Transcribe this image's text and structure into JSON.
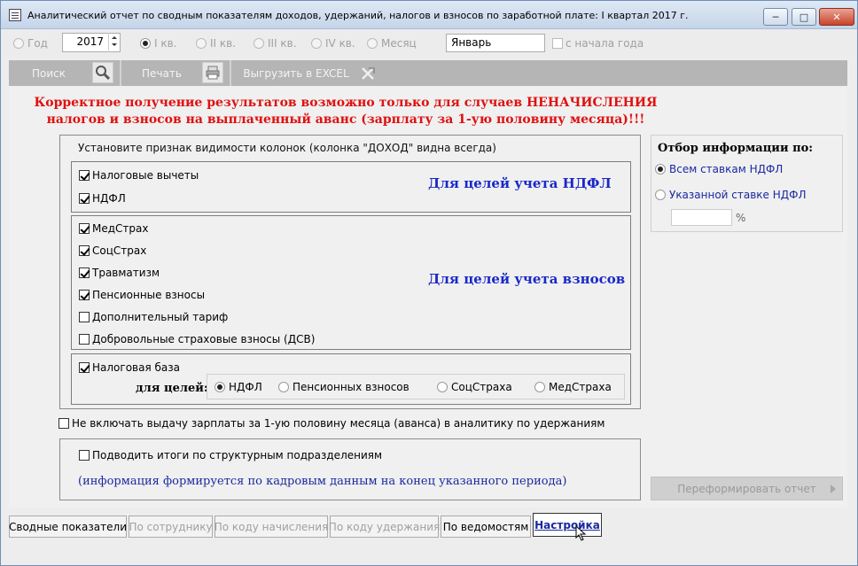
{
  "window": {
    "title": "Аналитический отчет по сводным показателям доходов, удержаний, налогов и взносов по заработной плате: I квартал 2017 г.",
    "minimize": "─",
    "maximize": "□",
    "close": "✕"
  },
  "period": {
    "year_label": "Год",
    "year_value": "2017",
    "q1": "I кв.",
    "q2": "II кв.",
    "q3": "III кв.",
    "q4": "IV кв.",
    "month_label": "Месяц",
    "month_value": "Январь",
    "from_year_start": "с начала года"
  },
  "toolbar": {
    "search": "Поиск",
    "print": "Печать",
    "export": "Выгрузить в EXCEL"
  },
  "warning": {
    "line1": "Корректное получение результатов возможно только для случаев НЕНАЧИСЛЕНИЯ",
    "line2": "налогов и взносов на выплаченный аванс (зарплату за 1-ую половину месяца)!!!"
  },
  "visibility": {
    "caption": "Установите признак видимости колонок (колонка \"ДОХОД\" видна всегда)",
    "ndfl_title": "Для целей учета НДФЛ",
    "tax_deductions": "Налоговые вычеты",
    "ndfl": "НДФЛ",
    "contrib_title": "Для целей учета взносов",
    "med": "МедСтрах",
    "soc": "СоцСтрах",
    "injury": "Травматизм",
    "pension": "Пенсионные взносы",
    "extra_tariff": "Дополнительный тариф",
    "voluntary": "Добровольные страховые взносы (ДСВ)",
    "tax_base": "Налоговая база",
    "purpose_label": "для целей:",
    "purpose_ndfl": "НДФЛ",
    "purpose_pension": "Пенсионных взносов",
    "purpose_soc": "СоцСтраха",
    "purpose_med": "МедСтраха"
  },
  "exclude_advance": "Не включать выдачу зарплаты за 1-ую половину месяца (аванса) в аналитику по удержаниям",
  "subdivisions": {
    "label": "Подводить итоги по структурным подразделениям",
    "note": "(информация формируется по кадровым данным на конец указанного периода)"
  },
  "filter": {
    "title": "Отбор информации по:",
    "all_rates": "Всем ставкам НДФЛ",
    "specified_rate": "Указанной ставке НДФЛ",
    "percent": "%"
  },
  "reform_button": "Переформировать отчет",
  "tabs": [
    {
      "label": "Сводные показатели"
    },
    {
      "label": "По сотруднику"
    },
    {
      "label": "По коду начисления"
    },
    {
      "label": "По коду удержания"
    },
    {
      "label": "По ведомостям"
    },
    {
      "label": "Настройка"
    }
  ]
}
